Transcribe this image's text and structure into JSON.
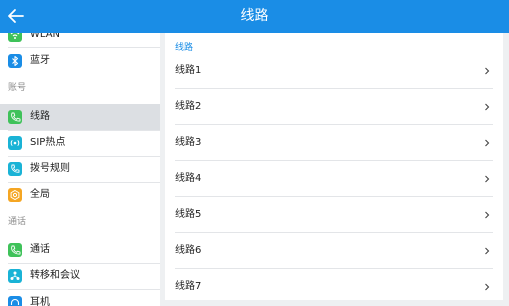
{
  "header": {
    "title": "线路"
  },
  "sidebar": {
    "items": [
      {
        "label": "WLAN",
        "icon": "wlan-icon",
        "color": "#3fc25a"
      },
      {
        "label": "蓝牙",
        "icon": "bluetooth-icon",
        "color": "#1a8de6"
      },
      {
        "label": "线路",
        "icon": "phone-line-icon",
        "color": "#3fc25a",
        "active": true
      },
      {
        "label": "SIP热点",
        "icon": "sip-hotspot-icon",
        "color": "#1ab3d6"
      },
      {
        "label": "拨号规则",
        "icon": "dial-rule-icon",
        "color": "#1ab3d6"
      },
      {
        "label": "全局",
        "icon": "global-gear-icon",
        "color": "#f5a623"
      },
      {
        "label": "通话",
        "icon": "call-icon",
        "color": "#3fc25a"
      },
      {
        "label": "转移和会议",
        "icon": "transfer-conference-icon",
        "color": "#1ab3d6"
      },
      {
        "label": "耳机",
        "icon": "headset-icon",
        "color": "#1a8de6"
      }
    ],
    "sections": {
      "account": "账号",
      "call": "通话"
    }
  },
  "content": {
    "header": "线路",
    "lines": [
      "线路1",
      "线路2",
      "线路3",
      "线路4",
      "线路5",
      "线路6",
      "线路7"
    ]
  }
}
